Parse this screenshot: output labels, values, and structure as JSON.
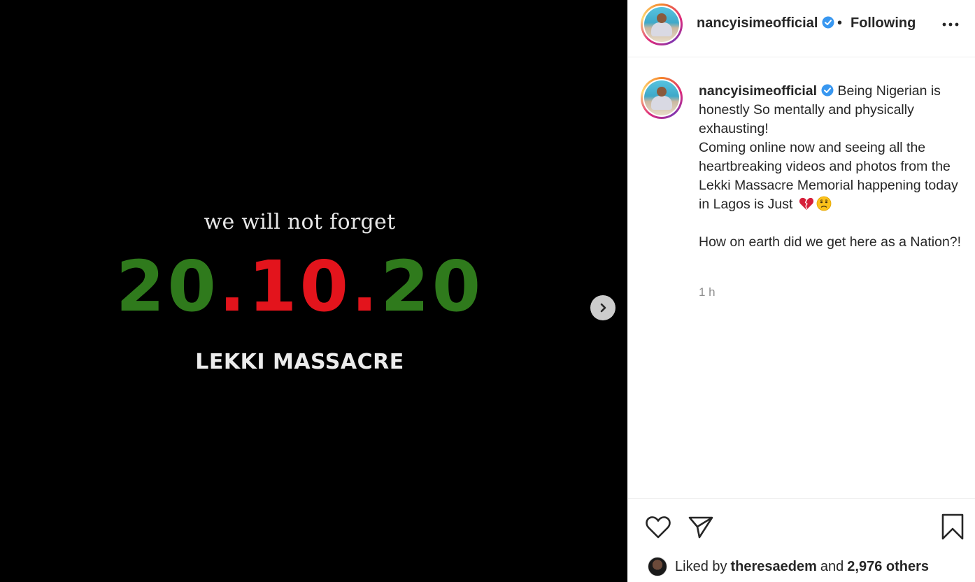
{
  "media": {
    "tagline": "we will not forget",
    "date_part1": "20",
    "date_part2": ".10.",
    "date_part3": "20",
    "headline": "LEKKI MASSACRE",
    "next_icon": "chevron-right-icon"
  },
  "header": {
    "username": "nancyisimeofficial",
    "dot": "•",
    "follow_status": "Following",
    "more_icon": "more-horizontal-icon"
  },
  "caption": {
    "username": "nancyisimeofficial",
    "text_line1": "Being Nigerian is honestly So mentally and physically exhausting!",
    "text_line2": "Coming online now and seeing all the heartbreaking videos and photos from the Lekki Massacre Memorial happening today in Lagos is Just",
    "text_line3": "How on earth did we get here as a Nation?!",
    "emojis": [
      "broken-heart-emoji",
      "frowning-face-emoji"
    ],
    "time": "1 h"
  },
  "actions": {
    "like_icon": "heart-icon",
    "share_icon": "send-icon",
    "save_icon": "bookmark-icon"
  },
  "likes": {
    "prefix": "Liked by",
    "user": "theresaedem",
    "and": "and",
    "others": "2,976 others"
  },
  "colors": {
    "green": "#2f7a1c",
    "red": "#e3141c",
    "verified_blue": "#3897f0"
  }
}
